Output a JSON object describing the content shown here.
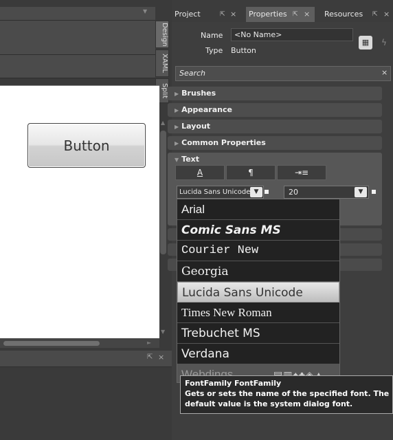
{
  "left": {
    "design_button_label": "Button",
    "view_tabs": [
      "Design",
      "XAML",
      "Split"
    ]
  },
  "tabs": [
    {
      "label": "Project",
      "active": false
    },
    {
      "label": "Properties",
      "active": true
    },
    {
      "label": "Resources",
      "active": false
    }
  ],
  "properties": {
    "name_label": "Name",
    "name_value": "<No Name>",
    "type_label": "Type",
    "type_value": "Button",
    "search_placeholder": "Search",
    "categories": [
      "Brushes",
      "Appearance",
      "Layout",
      "Common Properties",
      "Text"
    ],
    "text_tabs": [
      "A",
      "¶",
      "⇥≡"
    ],
    "font_family_value": "Lucida Sans Unicode",
    "font_size_value": "20"
  },
  "font_list": {
    "items": [
      "Arial",
      "Comic Sans MS",
      "Courier New",
      "Georgia",
      "Lucida Sans Unicode",
      "Times New Roman",
      "Trebuchet MS",
      "Verdana",
      "Webdings"
    ],
    "selected": "Lucida Sans Unicode"
  },
  "tooltip": {
    "title": "FontFamily  FontFamily",
    "line1": "Gets or sets the name of the specified font. The",
    "line2": "default value is the system dialog font."
  },
  "colors": {
    "panel_bg": "#3e3e3e",
    "accent_selected": "#d8d8d8"
  }
}
